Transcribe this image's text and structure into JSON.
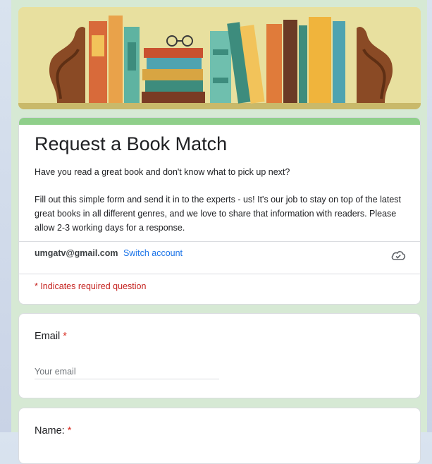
{
  "form": {
    "title": "Request a Book Match",
    "description_line1": "Have you read a great book and don't know what to pick up next?",
    "description_line2": "Fill out this simple form and send it in to the experts - us! It's our job to stay on top of the latest great books in all different genres, and we love to share that information with readers. Please allow 2-3 working days for a response."
  },
  "account": {
    "email": "umgatv@gmail.com",
    "switch_label": "Switch account"
  },
  "required_note": "* Indicates required question",
  "questions": [
    {
      "label": "Email",
      "required_mark": "*",
      "placeholder": "Your email"
    },
    {
      "label": "Name:",
      "required_mark": "*"
    }
  ],
  "colors": {
    "page_background": "#d6e9d4",
    "accent_bar": "#8fcf8a",
    "link": "#1a73e8",
    "required": "#d93025"
  },
  "icons": [
    "cloud-check-icon"
  ]
}
